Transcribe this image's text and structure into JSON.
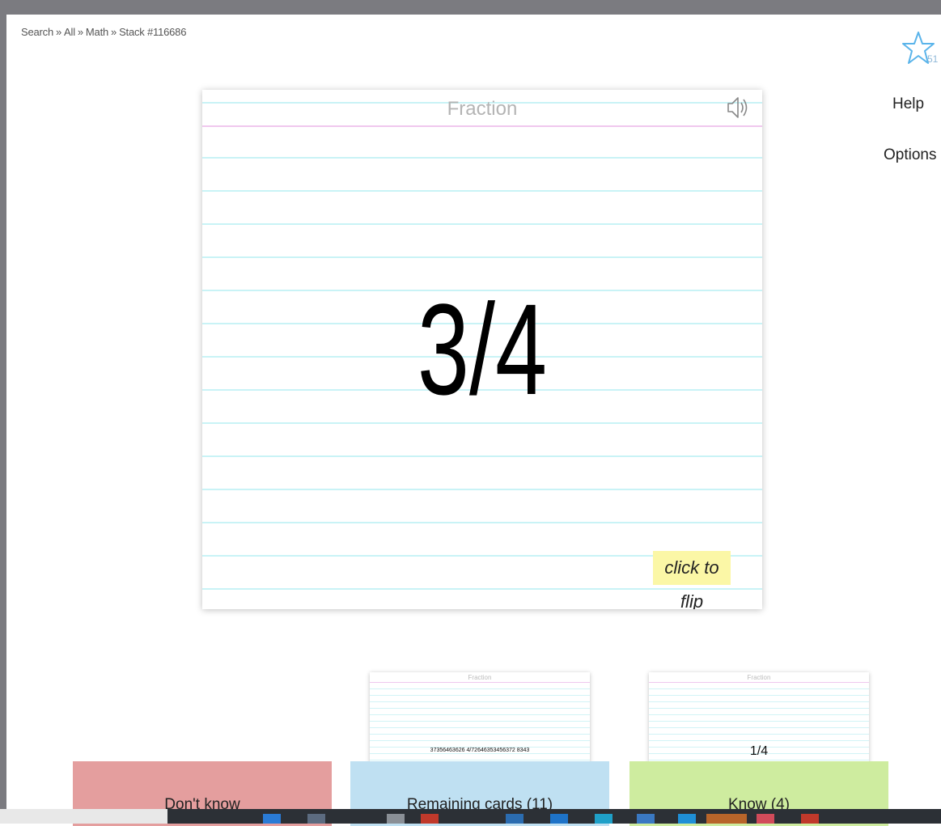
{
  "breadcrumb": {
    "items": [
      "Search",
      "All",
      "Math",
      "Stack #116686"
    ],
    "separator": "»"
  },
  "favorite": {
    "count": "51",
    "icon": "star-icon"
  },
  "menu": {
    "help": "Help",
    "options": "Options"
  },
  "card": {
    "title": "Fraction",
    "content": "3/4",
    "flip_label": "click to flip",
    "speaker_icon": "speaker-icon"
  },
  "mini_cards": {
    "left": {
      "title": "Fraction",
      "content": "37356463626 4/72646353456372 8343"
    },
    "right": {
      "title": "Fraction",
      "content": "1/4"
    }
  },
  "buttons": {
    "dont_know": "Don't know",
    "remaining": "Remaining cards (11)",
    "know": "Know (4)"
  },
  "colors": {
    "dont_know": "#e49e9e",
    "remaining": "#bfe0f2",
    "know": "#ceec9f",
    "flip_highlight": "#fbf7a6",
    "star": "#5ab4ea"
  }
}
